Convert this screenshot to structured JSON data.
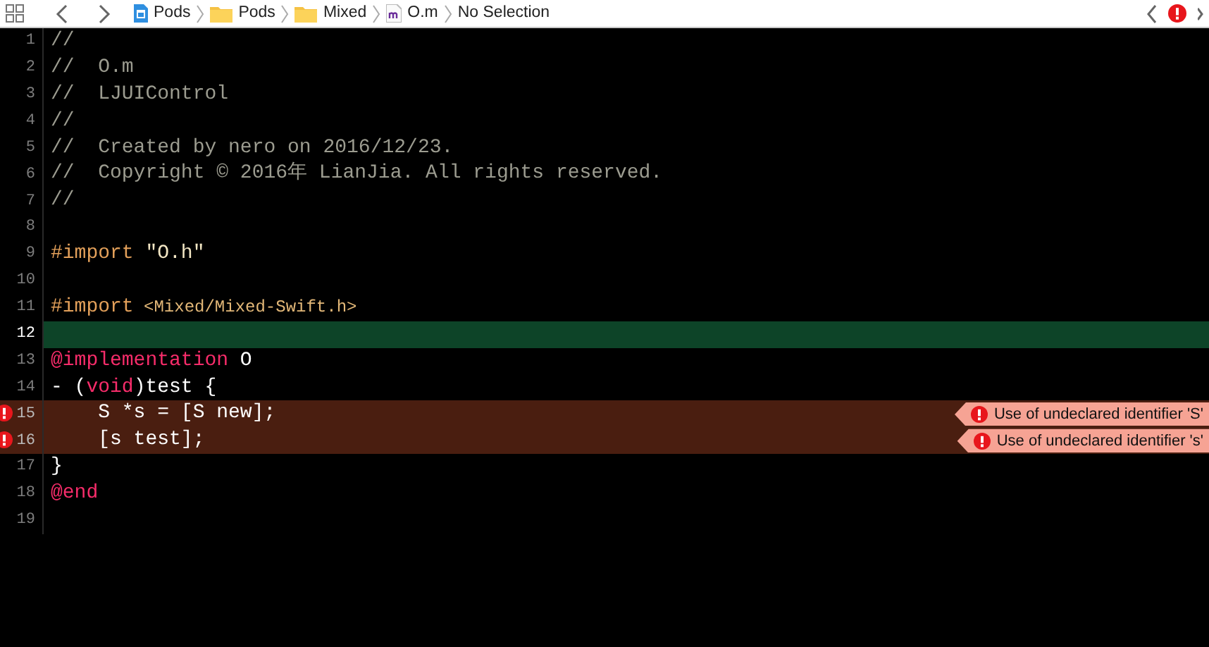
{
  "jump_bar": [
    {
      "label": "Pods",
      "kind": "project"
    },
    {
      "label": "Pods",
      "kind": "folder"
    },
    {
      "label": "Mixed",
      "kind": "folder"
    },
    {
      "label": "O.m",
      "kind": "m-file"
    },
    {
      "label": "No Selection"
    }
  ],
  "issue_count_icon": {
    "kind": "error"
  },
  "lines": [
    {
      "number": "1",
      "current": false,
      "error": false,
      "tokens": [
        {
          "kind": "comment",
          "text": "//"
        }
      ]
    },
    {
      "number": "2",
      "current": false,
      "error": false,
      "tokens": [
        {
          "kind": "comment",
          "text": "//  O.m"
        }
      ]
    },
    {
      "number": "3",
      "current": false,
      "error": false,
      "tokens": [
        {
          "kind": "comment",
          "text": "//  LJUIControl"
        }
      ]
    },
    {
      "number": "4",
      "current": false,
      "error": false,
      "tokens": [
        {
          "kind": "comment",
          "text": "//"
        }
      ]
    },
    {
      "number": "5",
      "current": false,
      "error": false,
      "tokens": [
        {
          "kind": "comment",
          "text": "//  Created by nero on 2016/12/23."
        }
      ]
    },
    {
      "number": "6",
      "current": false,
      "error": false,
      "tokens": [
        {
          "kind": "comment",
          "text": "//  Copyright © 2016年 LianJia. All rights reserved."
        }
      ]
    },
    {
      "number": "7",
      "current": false,
      "error": false,
      "tokens": [
        {
          "kind": "comment",
          "text": "//"
        }
      ]
    },
    {
      "number": "8",
      "current": false,
      "error": false
    },
    {
      "number": "9",
      "current": false,
      "error": false,
      "tokens": [
        {
          "kind": "preprocessor",
          "text": "#import"
        },
        {
          "kind": "string",
          "text": " \"O.h\""
        }
      ]
    },
    {
      "number": "10",
      "current": false,
      "error": false
    },
    {
      "number": "11",
      "current": false,
      "error": false,
      "tokens": [
        {
          "kind": "preprocessor",
          "text": "#import"
        },
        {
          "kind": "include",
          "text": " <Mixed/Mixed-Swift.h>"
        }
      ]
    },
    {
      "number": "12",
      "current": true,
      "error": false
    },
    {
      "number": "13",
      "current": false,
      "error": false,
      "tokens": [
        {
          "kind": "keyword",
          "text": "@implementation"
        },
        {
          "kind": "plain",
          "text": " O"
        }
      ]
    },
    {
      "number": "14",
      "current": false,
      "error": false,
      "tokens": [
        {
          "kind": "plain",
          "text": "- ("
        },
        {
          "kind": "keyword",
          "text": "void"
        },
        {
          "kind": "plain",
          "text": ")test {"
        }
      ]
    },
    {
      "number": "15",
      "current": false,
      "error": true,
      "issue": "Use of undeclared identifier 'S'",
      "tokens": [
        {
          "kind": "plain",
          "text": "    S *s = [S new];"
        }
      ]
    },
    {
      "number": "16",
      "current": false,
      "error": true,
      "issue": "Use of undeclared identifier 's'",
      "tokens": [
        {
          "kind": "plain",
          "text": "    [s test];"
        }
      ]
    },
    {
      "number": "17",
      "current": false,
      "error": false,
      "tokens": [
        {
          "kind": "plain",
          "text": "}"
        }
      ]
    },
    {
      "number": "18",
      "current": false,
      "error": false,
      "tokens": [
        {
          "kind": "keyword",
          "text": "@end"
        }
      ]
    },
    {
      "number": "19",
      "current": false,
      "error": false
    }
  ]
}
